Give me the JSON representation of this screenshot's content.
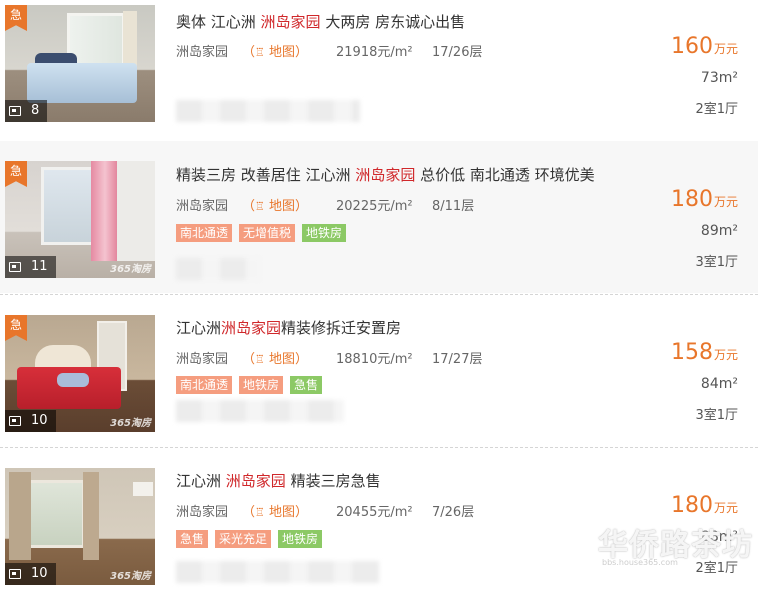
{
  "listings": [
    {
      "urgent_label": "急",
      "photo_count": "8",
      "title_pre": "奥体 江心洲 ",
      "title_kw": "洲岛家园",
      "title_post": " 大两房 房东诚心出售",
      "community": "洲岛家园",
      "map_label": "地图",
      "unit_price": "21918元/m²",
      "floor": "17/26层",
      "tags": [],
      "price": "160",
      "price_unit": "万元",
      "area": "73m²",
      "layout": "2室1厅"
    },
    {
      "urgent_label": "急",
      "photo_count": "11",
      "thumb_watermark": "365淘房",
      "title_pre": "精装三房 改善居住 江心洲 ",
      "title_kw": "洲岛家园",
      "title_post": " 总价低 南北通透 环境优美",
      "community": "洲岛家园",
      "map_label": "地图",
      "unit_price": "20225元/m²",
      "floor": "8/11层",
      "tags": [
        "南北通透",
        "无增值税",
        "地铁房"
      ],
      "price": "180",
      "price_unit": "万元",
      "area": "89m²",
      "layout": "3室1厅"
    },
    {
      "urgent_label": "急",
      "photo_count": "10",
      "thumb_watermark": "365淘房",
      "title_pre": "江心洲",
      "title_kw": "洲岛家园",
      "title_post": "精装修拆迁安置房",
      "community": "洲岛家园",
      "map_label": "地图",
      "unit_price": "18810元/m²",
      "floor": "17/27层",
      "tags": [
        "南北通透",
        "地铁房",
        "急售"
      ],
      "price": "158",
      "price_unit": "万元",
      "area": "84m²",
      "layout": "3室1厅"
    },
    {
      "photo_count": "10",
      "thumb_watermark": "365淘房",
      "title_pre": "江心洲 ",
      "title_kw": "洲岛家园",
      "title_post": " 精装三房急售",
      "community": "洲岛家园",
      "map_label": "地图",
      "unit_price": "20455元/m²",
      "floor": "7/26层",
      "tags": [
        "急售",
        "采光充足",
        "地铁房"
      ],
      "price": "180",
      "price_unit": "万元",
      "area": "88m²",
      "layout": "2室1厅"
    }
  ],
  "site_watermark": "华侨路茶坊",
  "site_watermark_url": "bbs.house365.com",
  "colors": {
    "accent": "#e8762b",
    "keyword": "#d0282b",
    "tag_orange": "#f59d7f",
    "tag_green": "#8cc965"
  }
}
